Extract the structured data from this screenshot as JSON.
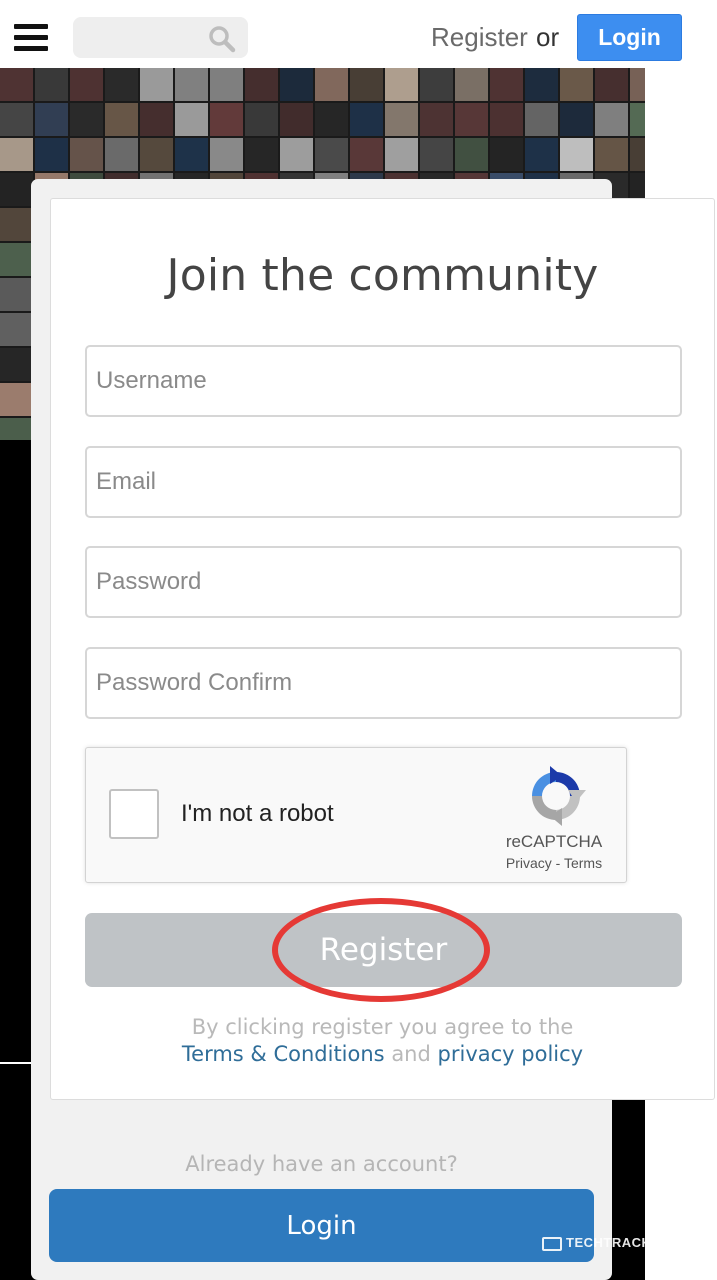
{
  "header": {
    "search_placeholder": "",
    "register_label": "Register",
    "or_label": "or",
    "login_label": "Login"
  },
  "form": {
    "title": "Join the community",
    "username_placeholder": "Username",
    "email_placeholder": "Email",
    "password_placeholder": "Password",
    "password_confirm_placeholder": "Password Confirm",
    "captcha": {
      "label": "I'm not a robot",
      "brand": "reCAPTCHA",
      "privacy": "Privacy",
      "separator": "-",
      "terms": "Terms",
      "checked": false
    },
    "register_label": "Register",
    "agree_text": "By clicking register you agree to the",
    "terms_link": "Terms & Conditions",
    "and_text": "and",
    "privacy_link": "privacy policy"
  },
  "footer": {
    "already_text": "Already have an account?",
    "login_label": "Login"
  },
  "watermark": "TECHTRACKER",
  "colors": {
    "login_blue": "#3d8ef0",
    "login_main_blue": "#2e7abe",
    "register_disabled": "#bfc3c6",
    "highlight_red": "#e53935",
    "link_blue": "#2f6d98"
  }
}
